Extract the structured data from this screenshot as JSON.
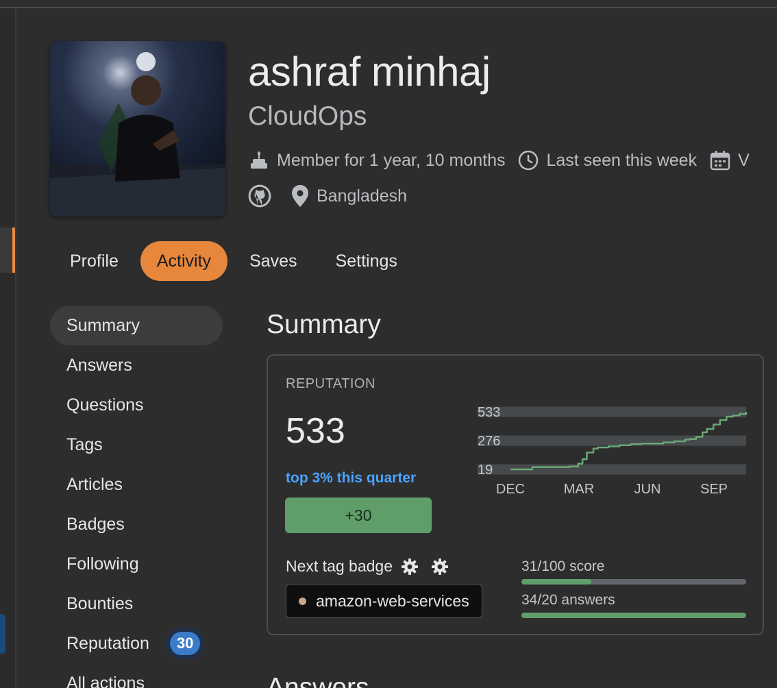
{
  "user": {
    "name": "ashraf minhaj",
    "title": "CloudOps",
    "member_for": "Member for 1 year, 10 months",
    "last_seen": "Last seen this week",
    "visited_partial": "V",
    "location": "Bangladesh"
  },
  "icons": {
    "member": "cake-icon",
    "last_seen": "clock-icon",
    "visited": "calendar-icon",
    "github": "github-icon",
    "location": "location-pin-icon",
    "settings": "gear-icon"
  },
  "tabs": [
    {
      "label": "Profile",
      "active": false
    },
    {
      "label": "Activity",
      "active": true
    },
    {
      "label": "Saves",
      "active": false
    },
    {
      "label": "Settings",
      "active": false
    }
  ],
  "side_nav": [
    {
      "label": "Summary",
      "active": true
    },
    {
      "label": "Answers"
    },
    {
      "label": "Questions"
    },
    {
      "label": "Tags"
    },
    {
      "label": "Articles"
    },
    {
      "label": "Badges"
    },
    {
      "label": "Following"
    },
    {
      "label": "Bounties"
    },
    {
      "label": "Reputation",
      "badge": "30"
    },
    {
      "label": "All actions"
    }
  ],
  "summary": {
    "heading": "Summary",
    "reputation_label": "REPUTATION",
    "reputation_value": "533",
    "rank_text": "top 3% this quarter",
    "change": "+30",
    "next_tag_badge_label": "Next tag badge",
    "tag_name": "amazon-web-services",
    "progress": [
      {
        "label": "31/100 score",
        "fraction": 0.31
      },
      {
        "label": "34/20 answers",
        "fraction": 1.0
      }
    ]
  },
  "next_section_heading": "Answers",
  "colors": {
    "accent": "#e7873c",
    "link": "#4aa3ff",
    "positive": "#5f9e6b",
    "badge_blue": "#3b7cc9"
  },
  "chart_data": {
    "type": "line",
    "y_ticks": [
      "533",
      "276",
      "19"
    ],
    "x_ticks": [
      "DEC",
      "MAR",
      "JUN",
      "SEP"
    ],
    "ylim": [
      19,
      533
    ],
    "x": [
      0,
      0.5,
      1,
      1.5,
      2,
      2.5,
      2.7,
      2.9,
      3.1,
      3.3,
      3.5,
      3.8,
      4,
      4.5,
      5,
      5.5,
      6,
      6.5,
      7,
      7.5,
      8,
      8.2,
      8.5,
      8.8,
      9,
      9.3,
      9.6,
      9.9,
      10.2,
      10.5,
      10.8
    ],
    "values": [
      19,
      19,
      40,
      40,
      40,
      40,
      45,
      45,
      70,
      110,
      170,
      205,
      215,
      225,
      235,
      245,
      250,
      250,
      260,
      270,
      285,
      290,
      310,
      350,
      380,
      420,
      460,
      490,
      500,
      515,
      533
    ]
  }
}
